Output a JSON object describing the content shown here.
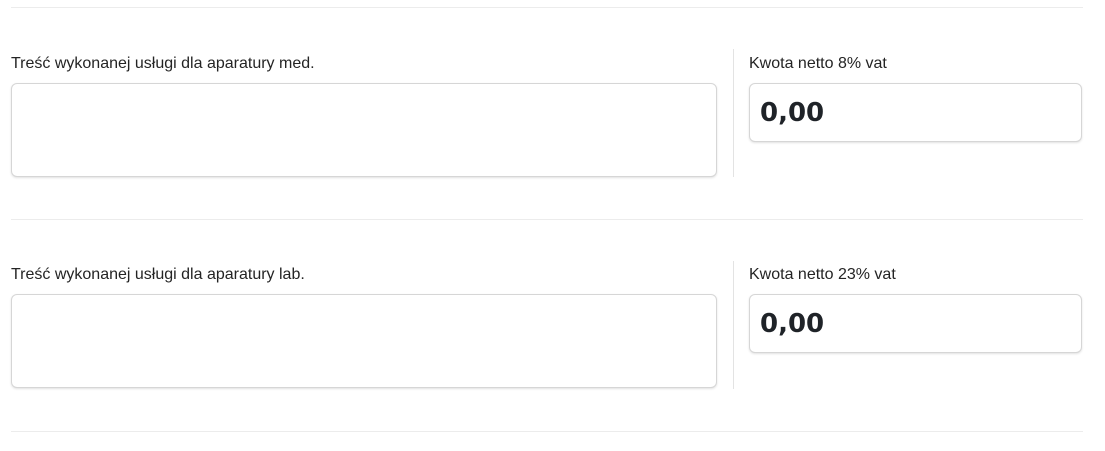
{
  "rows": [
    {
      "service_label": "Treść wykonanej usługi dla aparatury med.",
      "service_value": "",
      "amount_label": "Kwota netto 8% vat",
      "amount_value": "0,00"
    },
    {
      "service_label": "Treść wykonanej usługi dla aparatury lab.",
      "service_value": "",
      "amount_label": "Kwota netto 23% vat",
      "amount_value": "0,00"
    }
  ]
}
